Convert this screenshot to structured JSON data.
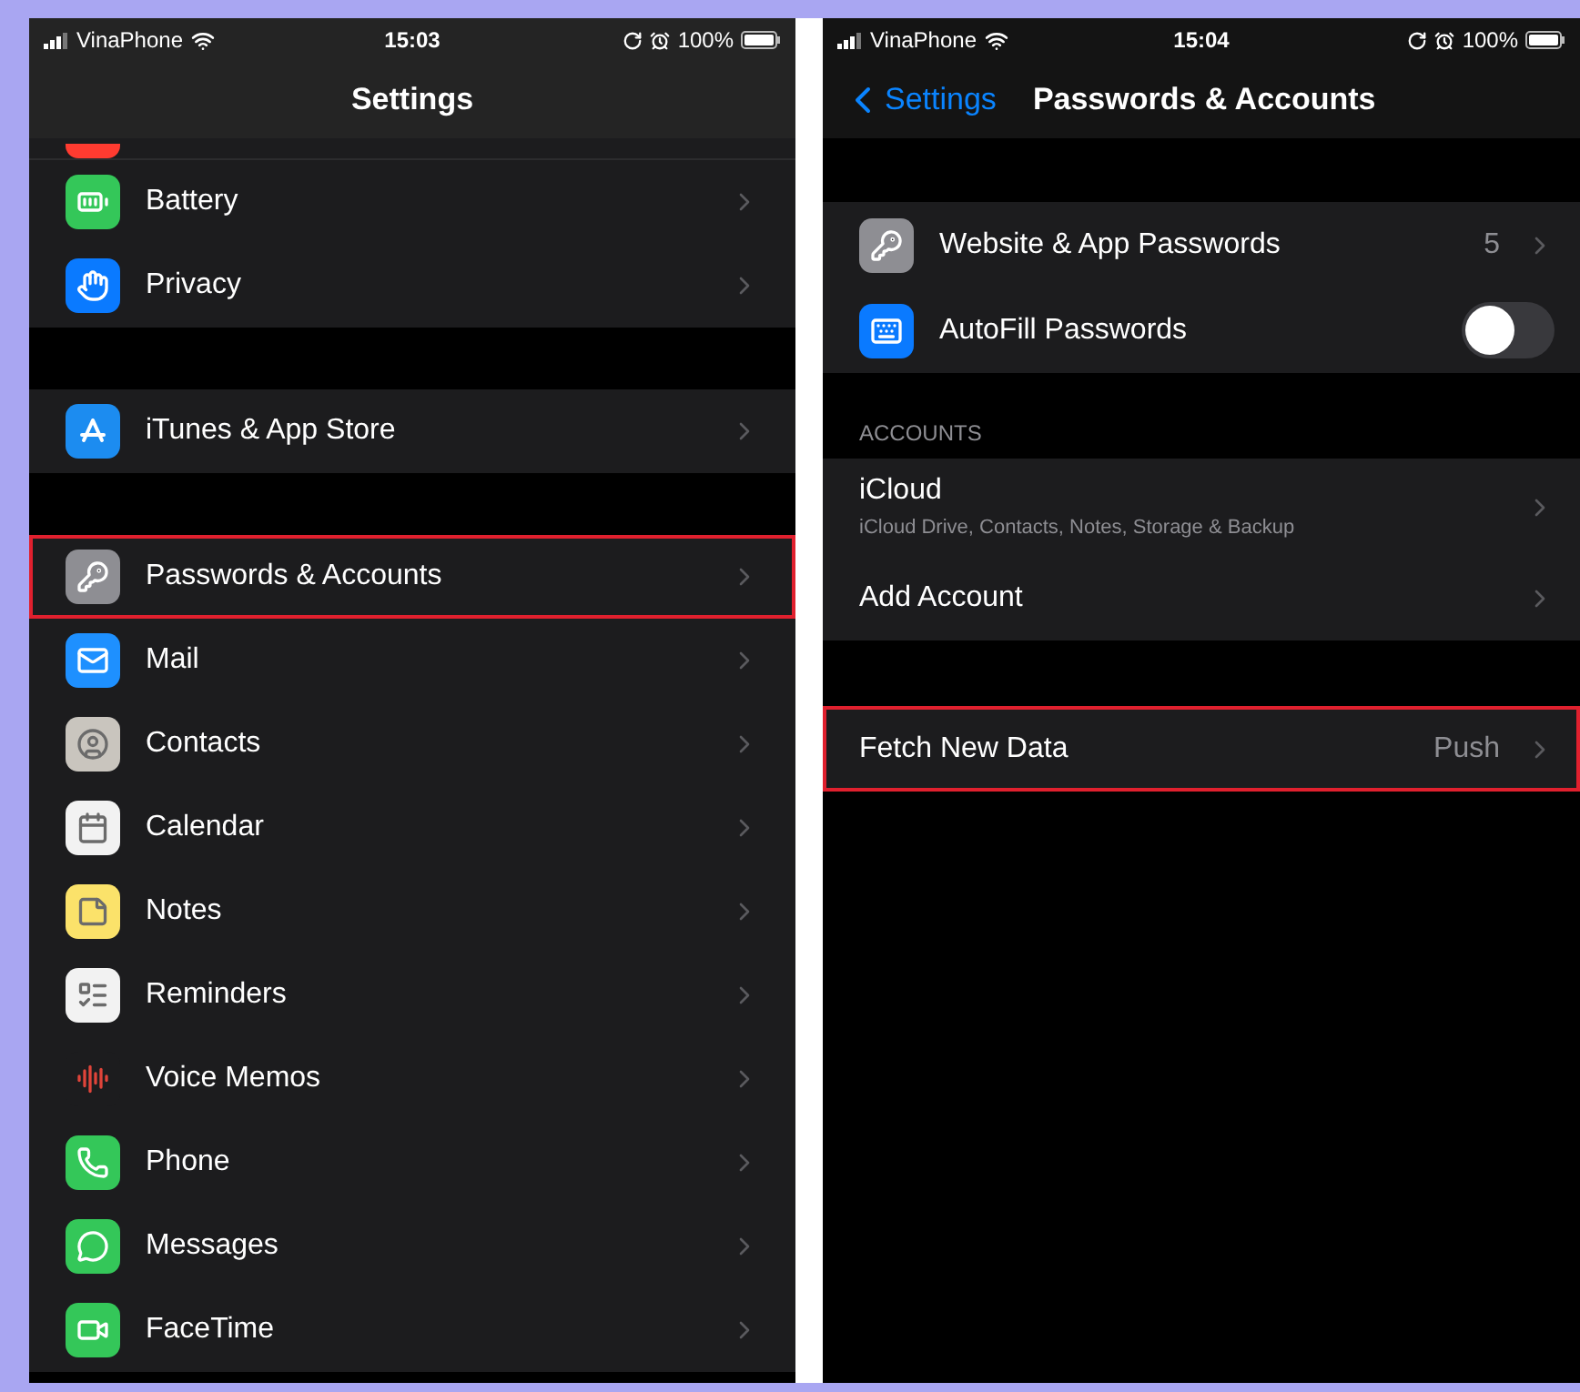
{
  "left_screen": {
    "status_bar": {
      "carrier": "VinaPhone",
      "time": "15:03",
      "battery": "100%"
    },
    "nav": {
      "title": "Settings"
    },
    "groups": [
      {
        "rows": [
          {
            "label": "Battery",
            "highlighted": false
          },
          {
            "label": "Privacy",
            "highlighted": false
          }
        ]
      },
      {
        "rows": [
          {
            "label": "iTunes & App Store",
            "highlighted": false
          }
        ]
      },
      {
        "rows": [
          {
            "label": "Passwords & Accounts",
            "highlighted": true
          },
          {
            "label": "Mail",
            "highlighted": false
          },
          {
            "label": "Contacts",
            "highlighted": false
          },
          {
            "label": "Calendar",
            "highlighted": false
          },
          {
            "label": "Notes",
            "highlighted": false
          },
          {
            "label": "Reminders",
            "highlighted": false
          },
          {
            "label": "Voice Memos",
            "highlighted": false
          },
          {
            "label": "Phone",
            "highlighted": false
          },
          {
            "label": "Messages",
            "highlighted": false
          },
          {
            "label": "FaceTime",
            "highlighted": false
          }
        ]
      }
    ]
  },
  "right_screen": {
    "status_bar": {
      "carrier": "VinaPhone",
      "time": "15:04",
      "battery": "100%"
    },
    "nav": {
      "back": "Settings",
      "title": "Passwords & Accounts"
    },
    "groups": [
      {
        "rows": [
          {
            "kind": "link",
            "label": "Website & App Passwords",
            "value": "5",
            "highlighted": false
          },
          {
            "kind": "toggle",
            "label": "AutoFill Passwords",
            "on": false,
            "highlighted": false
          }
        ]
      },
      {
        "header": "ACCOUNTS",
        "rows": [
          {
            "kind": "link",
            "label": "iCloud",
            "subtitle": "iCloud Drive, Contacts, Notes, Storage & Backup",
            "highlighted": false
          },
          {
            "kind": "link",
            "label": "Add Account",
            "highlighted": false
          }
        ]
      },
      {
        "rows": [
          {
            "kind": "link",
            "label": "Fetch New Data",
            "value": "Push",
            "highlighted": true
          }
        ]
      }
    ]
  }
}
